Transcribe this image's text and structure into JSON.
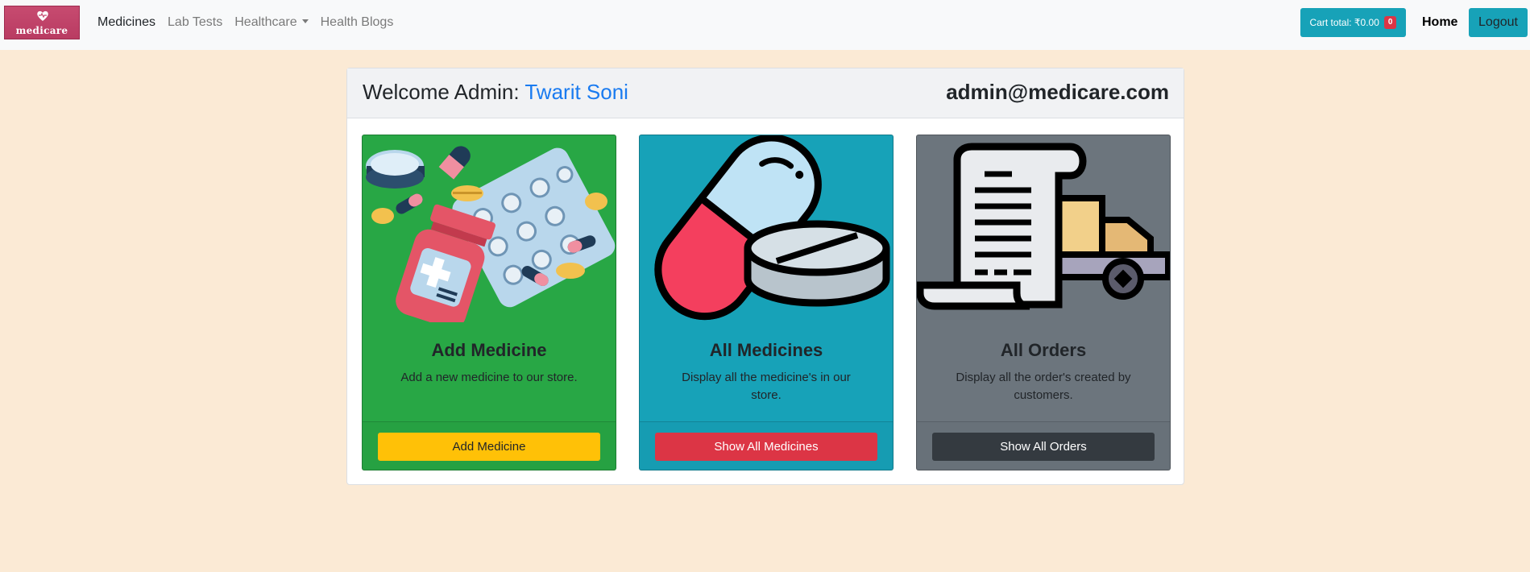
{
  "navbar": {
    "logo_text": "medicare",
    "links": [
      {
        "label": "Medicines"
      },
      {
        "label": "Lab Tests"
      },
      {
        "label": "Healthcare"
      },
      {
        "label": "Health Blogs"
      }
    ],
    "cart_label": "Cart total: ₹0.00",
    "cart_count": "0",
    "home_label": "Home",
    "logout_label": "Logout"
  },
  "main": {
    "welcome_prefix": "Welcome Admin:",
    "admin_name": "Twarit Soni",
    "admin_email": "admin@medicare.com",
    "tiles": [
      {
        "icon": "medicines-illustration-icon",
        "title": "Add Medicine",
        "text": "Add a new medicine to our store.",
        "button": "Add Medicine",
        "color": "#28a745",
        "button_color": "#ffc107"
      },
      {
        "icon": "capsule-pill-icon",
        "title": "All Medicines",
        "text": "Display all the medicine's in our store.",
        "button": "Show All Medicines",
        "color": "#17a2b8",
        "button_color": "#dc3545"
      },
      {
        "icon": "receipt-delivery-truck-icon",
        "title": "All Orders",
        "text": "Display all the order's created by customers.",
        "button": "Show All Orders",
        "color": "#6c757d",
        "button_color": "#343a40"
      }
    ]
  },
  "colors": {
    "page_background": "#fbead5",
    "accent": "#17a2b8",
    "admin_name": "#1a7bf0"
  }
}
